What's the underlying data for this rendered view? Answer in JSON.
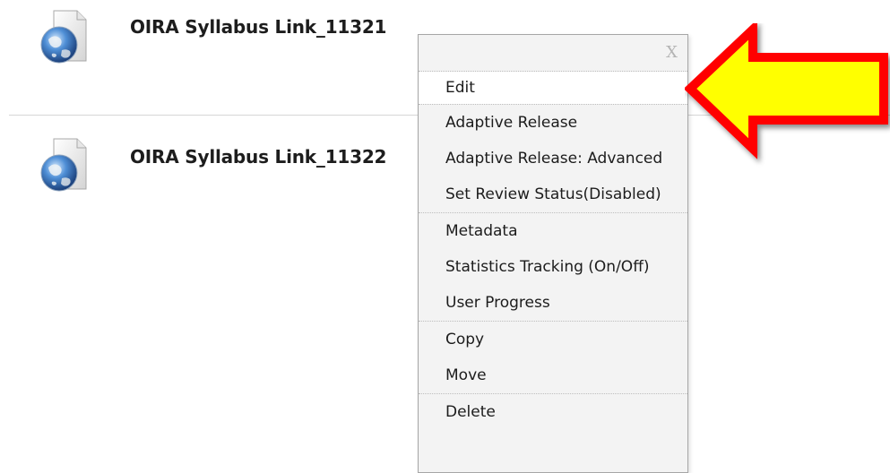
{
  "items": [
    {
      "title": "OIRA Syllabus Link_11321",
      "icon": "web-link-globe-icon"
    },
    {
      "title": "OIRA Syllabus Link_11322",
      "icon": "web-link-globe-icon"
    }
  ],
  "context_menu": {
    "close_label": "X",
    "groups": [
      [
        "Edit"
      ],
      [
        "Adaptive Release",
        "Adaptive Release: Advanced",
        "Set Review Status(Disabled)"
      ],
      [
        "Metadata",
        "Statistics Tracking (On/Off)",
        "User Progress"
      ],
      [
        "Copy",
        "Move"
      ],
      [
        "Delete"
      ]
    ]
  },
  "annotation": {
    "arrow_fill": "#ffff00",
    "arrow_stroke": "#ff0000",
    "points_to": "Edit"
  }
}
